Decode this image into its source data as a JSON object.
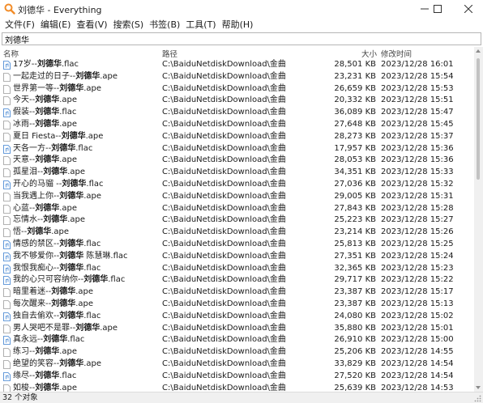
{
  "window": {
    "title": "刘德华 - Everything",
    "minimize_glyph": "—",
    "maximize_glyph": "☐",
    "close_glyph": "✕"
  },
  "menu": [
    "文件(F)",
    "编辑(E)",
    "查看(V)",
    "搜索(S)",
    "书签(B)",
    "工具(T)",
    "帮助(H)"
  ],
  "search": {
    "value": "刘德华"
  },
  "columns": {
    "name": "名称",
    "path": "路径",
    "size": "大小",
    "modified": "修改时间"
  },
  "files": [
    {
      "pre": "17岁--",
      "hl": "刘德华",
      "post": ".flac",
      "path": "C:\\BaiduNetdiskDownload\\金曲",
      "size": "28,501 KB",
      "date": "2023/12/28 16:01",
      "type": "flac"
    },
    {
      "pre": "一起走过的日子--",
      "hl": "刘德华",
      "post": ".ape",
      "path": "C:\\BaiduNetdiskDownload\\金曲",
      "size": "23,231 KB",
      "date": "2023/12/28 15:54",
      "type": "ape"
    },
    {
      "pre": "世界第一等--",
      "hl": "刘德华",
      "post": ".ape",
      "path": "C:\\BaiduNetdiskDownload\\金曲",
      "size": "26,659 KB",
      "date": "2023/12/28 15:53",
      "type": "ape"
    },
    {
      "pre": "今天--",
      "hl": "刘德华",
      "post": ".ape",
      "path": "C:\\BaiduNetdiskDownload\\金曲",
      "size": "20,332 KB",
      "date": "2023/12/28 15:51",
      "type": "ape"
    },
    {
      "pre": "假装--",
      "hl": "刘德华",
      "post": ".flac",
      "path": "C:\\BaiduNetdiskDownload\\金曲",
      "size": "36,089 KB",
      "date": "2023/12/28 15:47",
      "type": "flac"
    },
    {
      "pre": "冰雨--",
      "hl": "刘德华",
      "post": ".ape",
      "path": "C:\\BaiduNetdiskDownload\\金曲",
      "size": "27,648 KB",
      "date": "2023/12/28 15:45",
      "type": "ape"
    },
    {
      "pre": "夏日 Fiesta--",
      "hl": "刘德华",
      "post": ".ape",
      "path": "C:\\BaiduNetdiskDownload\\金曲",
      "size": "28,273 KB",
      "date": "2023/12/28 15:37",
      "type": "ape"
    },
    {
      "pre": "天各一方--",
      "hl": "刘德华",
      "post": ".flac",
      "path": "C:\\BaiduNetdiskDownload\\金曲",
      "size": "17,957 KB",
      "date": "2023/12/28 15:36",
      "type": "flac"
    },
    {
      "pre": "天意--",
      "hl": "刘德华",
      "post": ".ape",
      "path": "C:\\BaiduNetdiskDownload\\金曲",
      "size": "28,053 KB",
      "date": "2023/12/28 15:36",
      "type": "ape"
    },
    {
      "pre": "孤星泪--",
      "hl": "刘德华",
      "post": ".ape",
      "path": "C:\\BaiduNetdiskDownload\\金曲",
      "size": "34,351 KB",
      "date": "2023/12/28 15:33",
      "type": "ape"
    },
    {
      "pre": "开心的马骝 --",
      "hl": "刘德华",
      "post": ".flac",
      "path": "C:\\BaiduNetdiskDownload\\金曲",
      "size": "27,036 KB",
      "date": "2023/12/28 15:32",
      "type": "flac"
    },
    {
      "pre": "当我遇上你--",
      "hl": "刘德华",
      "post": ".ape",
      "path": "C:\\BaiduNetdiskDownload\\金曲",
      "size": "29,005 KB",
      "date": "2023/12/28 15:31",
      "type": "ape"
    },
    {
      "pre": "心蓝--",
      "hl": "刘德华",
      "post": ".ape",
      "path": "C:\\BaiduNetdiskDownload\\金曲",
      "size": "27,843 KB",
      "date": "2023/12/28 15:28",
      "type": "ape"
    },
    {
      "pre": "忘情水--",
      "hl": "刘德华",
      "post": ".ape",
      "path": "C:\\BaiduNetdiskDownload\\金曲",
      "size": "25,223 KB",
      "date": "2023/12/28 15:27",
      "type": "ape"
    },
    {
      "pre": "悟--",
      "hl": "刘德华",
      "post": ".ape",
      "path": "C:\\BaiduNetdiskDownload\\金曲",
      "size": "23,214 KB",
      "date": "2023/12/28 15:26",
      "type": "ape"
    },
    {
      "pre": "情感的禁区--",
      "hl": "刘德华",
      "post": ".flac",
      "path": "C:\\BaiduNetdiskDownload\\金曲",
      "size": "25,813 KB",
      "date": "2023/12/28 15:25",
      "type": "flac"
    },
    {
      "pre": "我不够爱你--",
      "hl": "刘德华",
      "post": " 陈慧琳.flac",
      "path": "C:\\BaiduNetdiskDownload\\金曲",
      "size": "27,351 KB",
      "date": "2023/12/28 15:24",
      "type": "flac"
    },
    {
      "pre": "我恨我痴心--",
      "hl": "刘德华",
      "post": ".flac",
      "path": "C:\\BaiduNetdiskDownload\\金曲",
      "size": "32,365 KB",
      "date": "2023/12/28 15:23",
      "type": "flac"
    },
    {
      "pre": "我的心只可容纳你--",
      "hl": "刘德华",
      "post": ".flac",
      "path": "C:\\BaiduNetdiskDownload\\金曲",
      "size": "29,717 KB",
      "date": "2023/12/28 15:22",
      "type": "flac"
    },
    {
      "pre": "暗里着迷--",
      "hl": "刘德华",
      "post": ".ape",
      "path": "C:\\BaiduNetdiskDownload\\金曲",
      "size": "23,387 KB",
      "date": "2023/12/28 15:17",
      "type": "ape"
    },
    {
      "pre": "每次醒来--",
      "hl": "刘德华",
      "post": ".ape",
      "path": "C:\\BaiduNetdiskDownload\\金曲",
      "size": "23,387 KB",
      "date": "2023/12/28 15:13",
      "type": "ape"
    },
    {
      "pre": "独自去偷欢--",
      "hl": "刘德华",
      "post": ".flac",
      "path": "C:\\BaiduNetdiskDownload\\金曲",
      "size": "24,080 KB",
      "date": "2023/12/28 15:02",
      "type": "flac"
    },
    {
      "pre": "男人哭吧不是罪--",
      "hl": "刘德华",
      "post": ".ape",
      "path": "C:\\BaiduNetdiskDownload\\金曲",
      "size": "35,880 KB",
      "date": "2023/12/28 15:01",
      "type": "ape"
    },
    {
      "pre": "真永远--",
      "hl": "刘德华",
      "post": ".flac",
      "path": "C:\\BaiduNetdiskDownload\\金曲",
      "size": "26,910 KB",
      "date": "2023/12/28 15:00",
      "type": "flac"
    },
    {
      "pre": "练习--",
      "hl": "刘德华",
      "post": ".ape",
      "path": "C:\\BaiduNetdiskDownload\\金曲",
      "size": "25,206 KB",
      "date": "2023/12/28 14:55",
      "type": "ape"
    },
    {
      "pre": "绝望的笑容--",
      "hl": "刘德华",
      "post": ".ape",
      "path": "C:\\BaiduNetdiskDownload\\金曲",
      "size": "33,829 KB",
      "date": "2023/12/28 14:54",
      "type": "ape"
    },
    {
      "pre": "缘尽--",
      "hl": "刘德华",
      "post": ".flac",
      "path": "C:\\BaiduNetdiskDownload\\金曲",
      "size": "27,520 KB",
      "date": "2023/12/28 14:54",
      "type": "flac"
    },
    {
      "pre": "如梭--",
      "hl": "刘德华",
      "post": ".ape",
      "path": "C:\\BaiduNetdiskDownload\\金曲",
      "size": "25,639 KB",
      "date": "2023/12/28 14:53",
      "type": "ape"
    }
  ],
  "status": {
    "text": "32 个对象"
  },
  "colors": {
    "accent": "#0a5cd6",
    "flac_icon": "#3a7fd0",
    "ape_icon": "#9a9a9a"
  }
}
